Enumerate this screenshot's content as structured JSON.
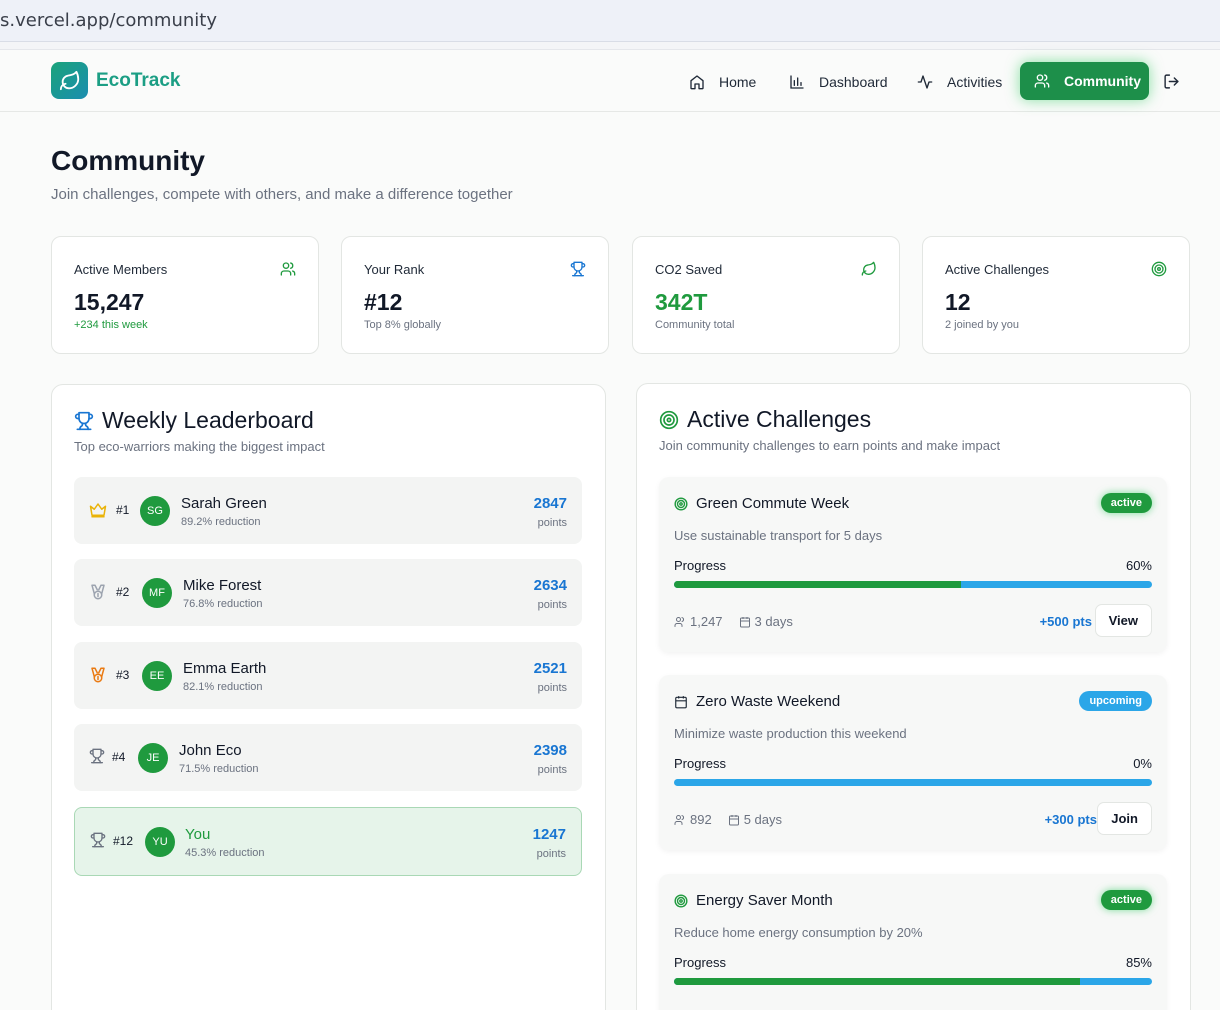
{
  "browser": {
    "url": "s.vercel.app/community"
  },
  "nav": {
    "brand": "EcoTrack",
    "items": [
      {
        "label": "Home",
        "icon": "home-icon"
      },
      {
        "label": "Dashboard",
        "icon": "bar-chart-icon"
      },
      {
        "label": "Activities",
        "icon": "activity-icon"
      },
      {
        "label": "Community",
        "icon": "users-icon",
        "active": true
      }
    ]
  },
  "page": {
    "title": "Community",
    "subtitle": "Join challenges, compete with others, and make a difference together"
  },
  "stats": [
    {
      "label": "Active Members",
      "value": "15,247",
      "note": "+234 this week",
      "icon": "users-icon"
    },
    {
      "label": "Your Rank",
      "value": "#12",
      "note": "Top 8% globally",
      "icon": "trophy-icon"
    },
    {
      "label": "CO2 Saved",
      "value": "342T",
      "note": "Community total",
      "icon": "leaf-icon"
    },
    {
      "label": "Active Challenges",
      "value": "12",
      "note": "2 joined by you",
      "icon": "target-icon"
    }
  ],
  "leaderboard": {
    "title": "Weekly Leaderboard",
    "subtitle": "Top eco-warriors making the biggest impact",
    "points_label": "points",
    "rows": [
      {
        "rank": "#1",
        "initials": "SG",
        "name": "Sarah Green",
        "reduction": "89.2% reduction",
        "points": "2847",
        "medal": "crown-icon"
      },
      {
        "rank": "#2",
        "initials": "MF",
        "name": "Mike Forest",
        "reduction": "76.8% reduction",
        "points": "2634",
        "medal": "silver-medal-icon"
      },
      {
        "rank": "#3",
        "initials": "EE",
        "name": "Emma Earth",
        "reduction": "82.1% reduction",
        "points": "2521",
        "medal": "bronze-medal-icon"
      },
      {
        "rank": "#4",
        "initials": "JE",
        "name": "John Eco",
        "reduction": "71.5% reduction",
        "points": "2398",
        "medal": "trophy-icon"
      },
      {
        "rank": "#12",
        "initials": "YU",
        "name": "You",
        "reduction": "45.3% reduction",
        "points": "1247",
        "medal": "trophy-icon"
      }
    ]
  },
  "challenges": {
    "title": "Active Challenges",
    "subtitle": "Join community challenges to earn points and make impact",
    "progress_label": "Progress",
    "items": [
      {
        "title": "Green Commute Week",
        "status": "active",
        "description": "Use sustainable transport for 5 days",
        "progress": 60,
        "progress_text": "60%",
        "participants": "1,247",
        "duration": "3 days",
        "reward": "+500 pts",
        "action": "View",
        "icon": "target-icon"
      },
      {
        "title": "Zero Waste Weekend",
        "status": "upcoming",
        "description": "Minimize waste production this weekend",
        "progress": 0,
        "progress_text": "0%",
        "participants": "892",
        "duration": "5 days",
        "reward": "+300 pts",
        "action": "Join",
        "icon": "calendar-icon"
      },
      {
        "title": "Energy Saver Month",
        "status": "active",
        "description": "Reduce home energy consumption by 20%",
        "progress": 85,
        "progress_text": "85%",
        "icon": "target-icon"
      }
    ]
  },
  "colors": {
    "primary": "#1f9a3e",
    "blue": "#1976d2",
    "sky": "#2ba6e8",
    "brand": "#1b9e84"
  }
}
